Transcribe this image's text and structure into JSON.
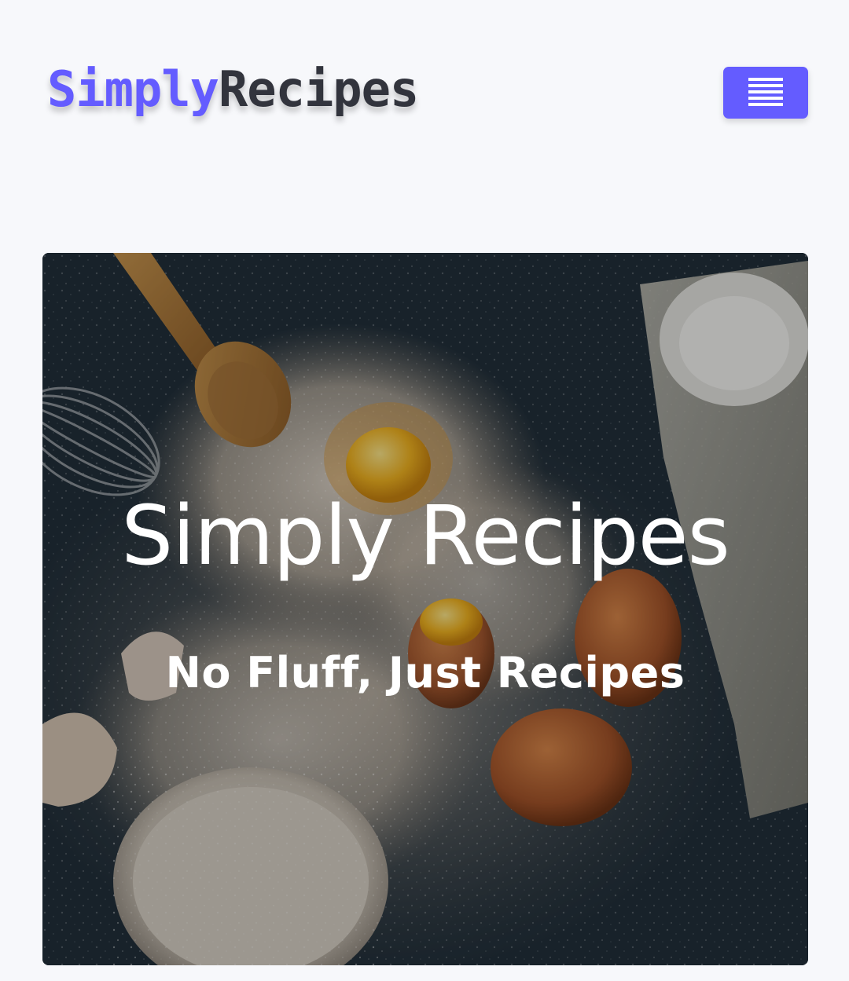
{
  "header": {
    "logo": {
      "part_1": "Simply",
      "part_2": "Recipes"
    },
    "menu_icon": "hamburger-menu-icon"
  },
  "hero": {
    "title": "Simply Recipes",
    "subtitle": "No Fluff, Just Recipes",
    "image_description": "baking-ingredients-photo"
  },
  "colors": {
    "brand_primary": "#645cff",
    "logo_dark": "#32343d",
    "page_background": "#f7f8fb",
    "hero_text": "#ffffff"
  }
}
